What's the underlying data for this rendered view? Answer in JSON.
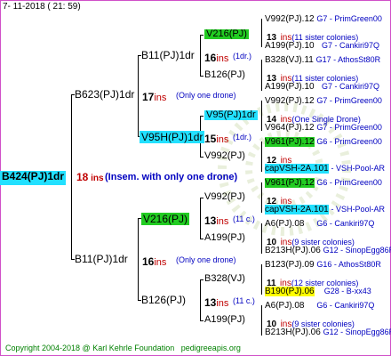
{
  "header": {
    "date": "7- 11-2018 ( 21: 59)"
  },
  "footer": {
    "copyright": "Copyright 2004-2018 @ Karl Kehrle Foundation",
    "site": "pedigreeapis.org"
  },
  "root": {
    "name": "B424(PJ)1dr",
    "ins": "18",
    "ins_label": "ins",
    "sub": "(Insem. with only one drone)"
  },
  "gen1": {
    "top": {
      "name": "B623(PJ)1dr",
      "ins": "17",
      "ins_label": "ins",
      "sub": "(Only one drone)"
    },
    "bottom": {
      "name": "B11(PJ)1dr",
      "ins": "16",
      "ins_label": "ins",
      "sub": "(Only one drone)"
    }
  },
  "gen2": {
    "a": {
      "name": "B11(PJ)1dr",
      "ins": "16",
      "ins_label": "ins",
      "sub": "(1dr.)"
    },
    "b": {
      "name": "V95H(PJ)1dr",
      "ins": "15",
      "ins_label": "ins",
      "sub": "(1dr.)"
    },
    "c": {
      "name": "V216(PJ)",
      "ins": "13",
      "ins_label": "ins",
      "sub": "(11 c.)"
    },
    "d": {
      "name": "B126(PJ)",
      "ins": "13",
      "ins_label": "ins",
      "sub": "(11 c.)"
    }
  },
  "gen3": {
    "a1": {
      "name": "V216(PJ)",
      "ins": "13",
      "ins_label": "ins",
      "sub": "(11 sister colonies)"
    },
    "a2": {
      "name": "B126(PJ)",
      "ins": "13",
      "ins_label": "ins",
      "sub": "(11 sister colonies)"
    },
    "b1": {
      "name": "V95(PJ)1dr",
      "ins": "14",
      "ins_label": "ins",
      "sub": "(One Single Drone)"
    },
    "b2": {
      "name": "V992(PJ)",
      "ins": "12",
      "ins_label": "ins"
    },
    "c1": {
      "name": "V992(PJ)",
      "ins": "12",
      "ins_label": "ins"
    },
    "c2": {
      "name": "A199(PJ)",
      "ins": "10",
      "ins_label": "ins",
      "sub": "(9 sister colonies)"
    },
    "d1": {
      "name": "B328(VJ)",
      "ins": "11",
      "ins_label": "ins",
      "sub": "(12 sister colonies)"
    },
    "d2": {
      "name": "A199(PJ)",
      "ins": "10",
      "ins_label": "ins",
      "sub": "(9 sister colonies)"
    }
  },
  "gen4": [
    {
      "name": "V992(PJ).12",
      "col": "G7 - PrimGreen00"
    },
    {
      "name": "A199(PJ).10",
      "col": "G7 - Cankiri97Q"
    },
    {
      "name": "B328(VJ).11",
      "col": "G17 - AthosSt80R"
    },
    {
      "name": "A199(PJ).10",
      "col": "G7 - Cankiri97Q"
    },
    {
      "name": "V992(PJ).12",
      "col": "G7 - PrimGreen00"
    },
    {
      "name": "V964(PJ).12",
      "col": "G7 - PrimGreen00"
    },
    {
      "name": "V961(PJ).12",
      "col": "G6 - PrimGreen00"
    },
    {
      "name": "capVSH-2A.101",
      "col": "- VSH-Pool-AR"
    },
    {
      "name": "V961(PJ).12",
      "col": "G6 - PrimGreen00"
    },
    {
      "name": "capVSH-2A.101",
      "col": "- VSH-Pool-AR"
    },
    {
      "name": "A6(PJ).08",
      "col": "G6 - Cankiri97Q"
    },
    {
      "name": "B213H(PJ).06",
      "col": "G12 - SinopEgg86R"
    },
    {
      "name": "B123(PJ).09",
      "col": "G16 - AthosSt80R"
    },
    {
      "name": "B190(PJ).06",
      "col": "G28 - B-xx43"
    },
    {
      "name": "A6(PJ).08",
      "col": "G6 - Cankiri97Q"
    },
    {
      "name": "B213H(PJ).06",
      "col": "G12 - SinopEgg86R"
    }
  ],
  "colors": {
    "frame": "#d050c8",
    "ins": "#c00000",
    "sub": "#0000c0",
    "green": "#22cc22",
    "cyan": "#22e0ff",
    "yellow": "#ffff00"
  }
}
